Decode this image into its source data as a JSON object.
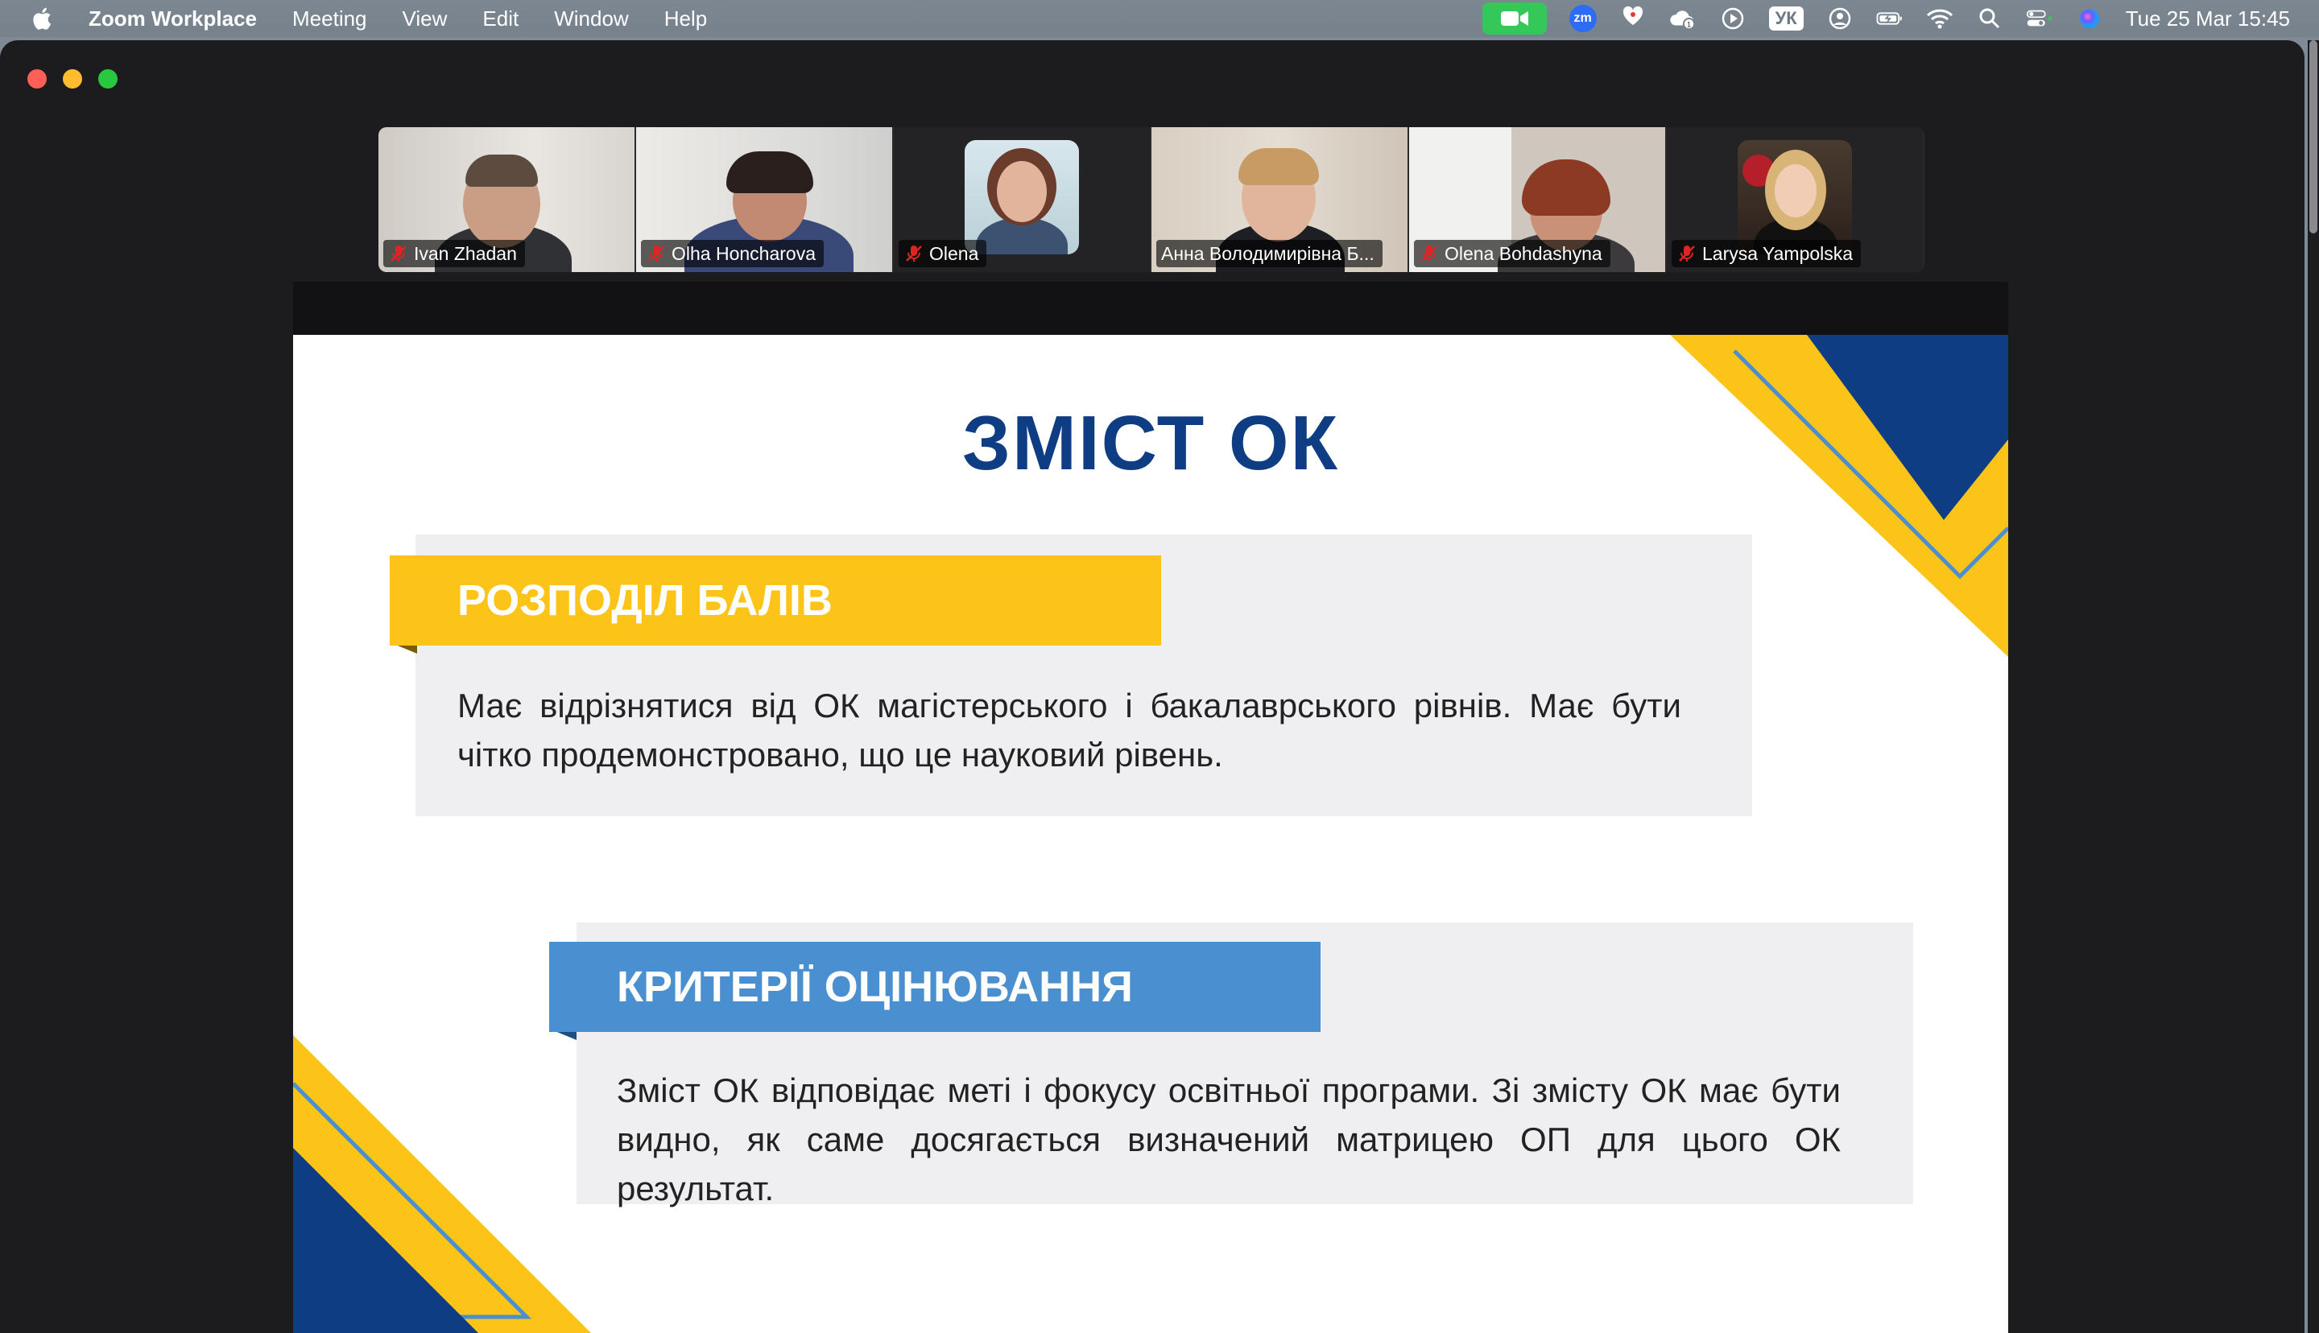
{
  "menubar": {
    "app_name": "Zoom Workplace",
    "menus": [
      "Meeting",
      "View",
      "Edit",
      "Window",
      "Help"
    ],
    "input_source": "УК",
    "clock": "Tue 25 Mar  15:45",
    "zoom_tray_color": "#34c759"
  },
  "participants": [
    {
      "name": "Ivan Zhadan",
      "muted": true
    },
    {
      "name": "Olha Honcharova",
      "muted": true
    },
    {
      "name": "Olena",
      "muted": true
    },
    {
      "name": "Анна Володимирівна Б...",
      "muted": false,
      "active_speaker": true
    },
    {
      "name": "Olena Bohdashyna",
      "muted": true
    },
    {
      "name": "Larysa Yampolska",
      "muted": true
    }
  ],
  "slide": {
    "title": "ЗМІСТ ОК",
    "section1": {
      "heading": "РОЗПОДІЛ БАЛІВ",
      "text": "Має відрізнятися від ОК магістерського і бакалаврського рівнів. Має бути чітко продемонстровано, що це науковий рівень."
    },
    "section2": {
      "heading": "КРИТЕРІЇ ОЦІНЮВАННЯ",
      "text": "Зміст ОК відповідає меті і фокусу освітньої програми. Зі змісту ОК має бути видно, як саме досягається визначений матрицею ОП для цього ОК результат."
    },
    "colors": {
      "navy": "#0f3d84",
      "yellow": "#fcc419",
      "blue": "#4a90d0",
      "panel": "#efeff1"
    }
  }
}
